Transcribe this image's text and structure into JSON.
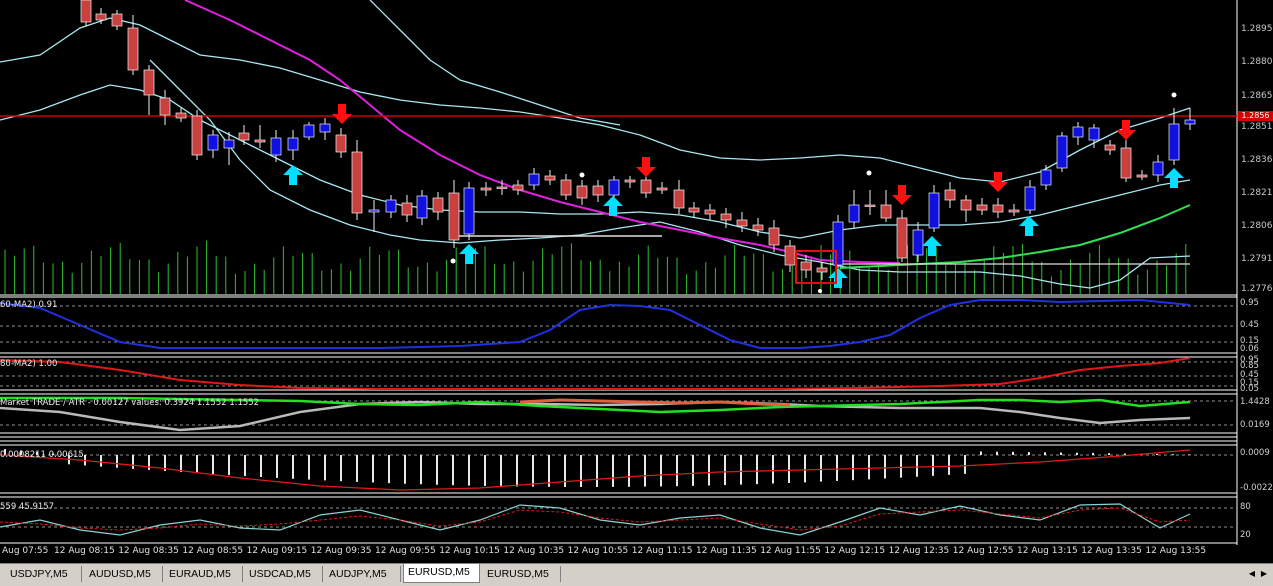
{
  "price_scale": [
    "1.28955",
    "1.28800",
    "1.28650",
    "1.28510",
    "1.28360",
    "1.28210",
    "1.28060",
    "1.27910",
    "1.27765"
  ],
  "current_price_badge": "1.2856",
  "indicators": {
    "ind1": {
      "label": "60-MA2) 0.91",
      "scale": [
        "0.95",
        "0.45",
        "0.15",
        "0.06"
      ]
    },
    "ind2": {
      "label": "80-MA2) 1.00",
      "scale": [
        "0.95",
        "0.85",
        "0.45",
        "0.15",
        "0.05"
      ]
    },
    "ind3": {
      "label": "Market TRADE / ATR - 0.00127   values: 0.3924 1.1552 1.1552",
      "scale": [
        "1.4428",
        "0.0169"
      ]
    },
    "ind4": {
      "label": "0.0008211 0.00615",
      "scale": [
        "0.0009",
        "-0.0022"
      ]
    },
    "ind5": {
      "label": "559 45.9157",
      "scale": [
        "80",
        "20"
      ]
    }
  },
  "time_axis": [
    "Aug 07:55",
    "12 Aug 08:15",
    "12 Aug 08:35",
    "12 Aug 08:55",
    "12 Aug 09:15",
    "12 Aug 09:35",
    "12 Aug 09:55",
    "12 Aug 10:15",
    "12 Aug 10:35",
    "12 Aug 10:55",
    "12 Aug 11:15",
    "12 Aug 11:35",
    "12 Aug 11:55",
    "12 Aug 12:15",
    "12 Aug 12:35",
    "12 Aug 12:55",
    "12 Aug 13:15",
    "12 Aug 13:35",
    "12 Aug 13:55"
  ],
  "tabs": [
    {
      "label": "USDJPY,M5"
    },
    {
      "label": "AUDUSD,M5"
    },
    {
      "label": "EURAUD,M5"
    },
    {
      "label": "USDCAD,M5"
    },
    {
      "label": "AUDJPY,M5"
    },
    {
      "label": "EURUSD,M5"
    },
    {
      "label": "EURUSD,M5"
    }
  ],
  "active_tab_index": 5,
  "colors": {
    "bull": "#1010e0",
    "bear": "#c84040",
    "up_arrow": "#00e0ff",
    "down_arrow": "#ff1010",
    "band": "#a8e8f0",
    "ma_magenta": "#e020e0",
    "resistance": "#d00000"
  }
}
